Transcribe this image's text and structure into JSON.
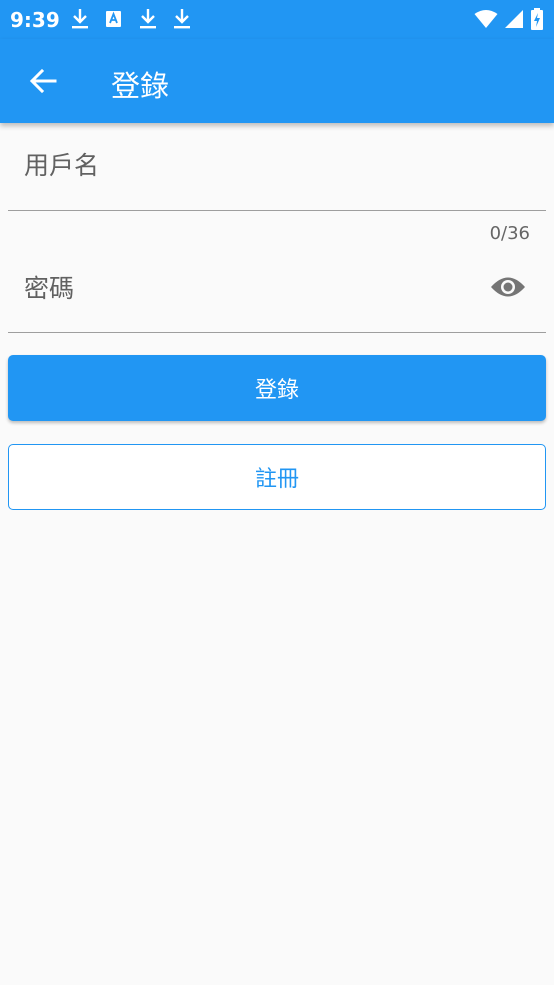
{
  "status_bar": {
    "time": "9:39",
    "notification_icons": [
      "download-icon",
      "font-icon",
      "download-icon",
      "download-icon"
    ],
    "right_icons": [
      "wifi-icon",
      "signal-icon",
      "battery-charging-icon"
    ]
  },
  "app_bar": {
    "title": "登錄",
    "back_icon": "arrow-left-icon"
  },
  "form": {
    "username": {
      "placeholder": "用戶名",
      "value": "",
      "counter": "0/36"
    },
    "password": {
      "placeholder": "密碼",
      "value": "",
      "toggle_icon": "eye-icon"
    }
  },
  "buttons": {
    "login_label": "登錄",
    "register_label": "註冊"
  },
  "colors": {
    "primary": "#2196f3",
    "background": "#fafafa",
    "divider": "#9e9e9e"
  }
}
